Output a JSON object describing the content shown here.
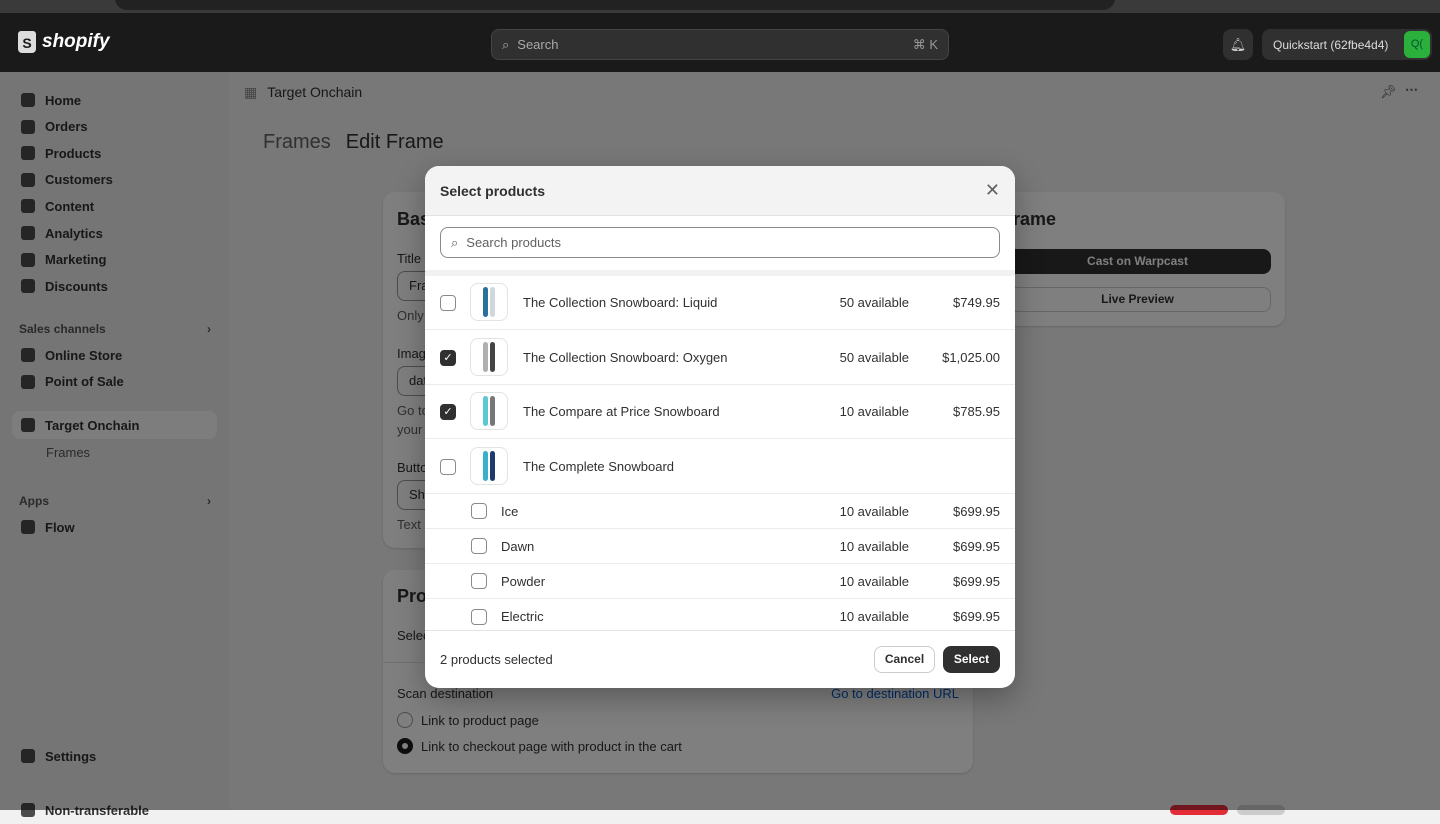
{
  "topbar": {
    "brand": "shopify",
    "search_placeholder": "Search",
    "search_shortcut": "⌘ K",
    "store_name": "Quickstart (62fbe4d4)",
    "store_initials": "Q("
  },
  "sidebar": {
    "items": [
      {
        "label": "Home",
        "icon": "home-icon"
      },
      {
        "label": "Orders",
        "icon": "orders-icon"
      },
      {
        "label": "Products",
        "icon": "tag-icon"
      },
      {
        "label": "Customers",
        "icon": "person-icon"
      },
      {
        "label": "Content",
        "icon": "content-icon"
      },
      {
        "label": "Analytics",
        "icon": "chart-icon"
      },
      {
        "label": "Marketing",
        "icon": "target-icon"
      },
      {
        "label": "Discounts",
        "icon": "discount-icon"
      }
    ],
    "sales_channels_label": "Sales channels",
    "channels": [
      {
        "label": "Online Store"
      },
      {
        "label": "Point of Sale"
      }
    ],
    "app_active": "Target Onchain",
    "app_sub": "Frames",
    "apps_label": "Apps",
    "apps": [
      {
        "label": "Flow"
      }
    ],
    "settings": "Settings",
    "bottom_notice": "Non-transferable"
  },
  "page": {
    "app_title": "Target Onchain",
    "breadcrumb": "Frames",
    "title": "Edit Frame",
    "basic_card": {
      "heading": "Bas",
      "title_label": "Title",
      "title_value": "Fra",
      "title_help": "Only",
      "image_label": "Imag",
      "image_value": "dat",
      "image_help1": "Go to",
      "image_help2": "your",
      "button_label": "Butto",
      "button_value": "Sh",
      "button_help": "Text"
    },
    "products_card": {
      "heading": "Pro",
      "select_text": "Selec",
      "scan_label": "Scan destination",
      "dest_link": "Go to destination URL",
      "radio1": "Link to product page",
      "radio2": "Link to checkout page with product in the cart",
      "selected_radio": 2
    },
    "frame_card": {
      "heading": "rame",
      "cast_button": "Cast on Warpcast",
      "preview_button": "Live Preview"
    }
  },
  "modal": {
    "title": "Select products",
    "search_placeholder": "Search products",
    "products": [
      {
        "name": "The Collection Snowboard: Liquid",
        "available": "50 available",
        "price": "$749.95",
        "checked": false,
        "colors": [
          "#2a6f9e",
          "#cfd8dc"
        ]
      },
      {
        "name": "The Collection Snowboard: Oxygen",
        "available": "50 available",
        "price": "$1,025.00",
        "checked": true,
        "colors": [
          "#b0b0b0",
          "#444"
        ]
      },
      {
        "name": "The Compare at Price Snowboard",
        "available": "10 available",
        "price": "$785.95",
        "checked": true,
        "colors": [
          "#5cc8d4",
          "#777"
        ]
      },
      {
        "name": "The Complete Snowboard",
        "available": "",
        "price": "",
        "checked": false,
        "colors": [
          "#3bb0c9",
          "#1e3a6e"
        ]
      }
    ],
    "variants": [
      {
        "name": "Ice",
        "available": "10 available",
        "price": "$699.95"
      },
      {
        "name": "Dawn",
        "available": "10 available",
        "price": "$699.95"
      },
      {
        "name": "Powder",
        "available": "10 available",
        "price": "$699.95"
      },
      {
        "name": "Electric",
        "available": "10 available",
        "price": "$699.95"
      }
    ],
    "selected_count": "2 products selected",
    "cancel": "Cancel",
    "select": "Select"
  }
}
